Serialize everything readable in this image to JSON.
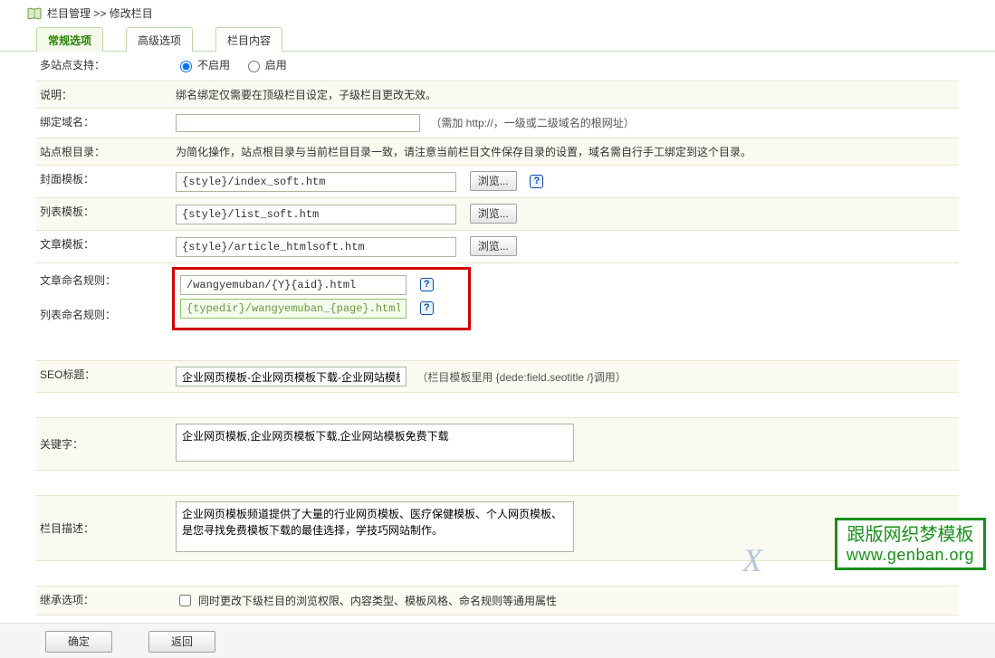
{
  "breadcrumb": {
    "main": "栏目管理",
    "sep": ">>",
    "sub": "修改栏目"
  },
  "tabs": {
    "normal": "常规选项",
    "advanced": "高级选项",
    "content": "栏目内容"
  },
  "labels": {
    "multisite": "多站点支持：",
    "note": "说明：",
    "bind_domain": "绑定域名：",
    "site_root": "站点根目录：",
    "cover_tpl": "封面模板：",
    "list_tpl": "列表模板：",
    "article_tpl": "文章模板：",
    "article_rule": "文章命名规则：",
    "list_rule": "列表命名规则：",
    "seo_title": "SEO标题：",
    "keywords": "关键字：",
    "description": "栏目描述：",
    "inherit": "继承选项："
  },
  "radios": {
    "disable": "不启用",
    "enable": "启用"
  },
  "texts": {
    "note_text": "绑名绑定仅需要在顶级栏目设定，子级栏目更改无效。",
    "domain_hint": "（需加 http://，一级或二级域名的根网址）",
    "site_root_text": "为简化操作，站点根目录与当前栏目目录一致，请注意当前栏目文件保存目录的设置，域名需自行手工绑定到这个目录。",
    "seo_hint": "（栏目模板里用 {dede:field.seotitle /}调用）",
    "inherit_text": "同时更改下级栏目的浏览权限、内容类型、模板风格、命名规则等通用属性"
  },
  "values": {
    "domain": "",
    "cover_tpl": "{style}/index_soft.htm",
    "list_tpl": "{style}/list_soft.htm",
    "article_tpl": "{style}/article_htmlsoft.htm",
    "article_rule": "/wangyemuban/{Y}{aid}.html",
    "list_rule": "{typedir}/wangyemuban_{page}.html",
    "seo_title": "企业网页模板-企业网页模板下载-企业网站模板",
    "keywords": "企业网页模板,企业网页模板下载,企业网站模板免费下载",
    "description": "企业网页模板频道提供了大量的行业网页模板、医疗保健模板、个人网页模板、是您寻找免费模板下载的最佳选择，学技巧网站制作。"
  },
  "buttons": {
    "browse": "浏览...",
    "confirm": "确定",
    "back": "返回"
  },
  "help_q": "?",
  "badge": {
    "line1": "跟版网织梦模板",
    "line2": "www.genban.org"
  },
  "watermark": "X"
}
